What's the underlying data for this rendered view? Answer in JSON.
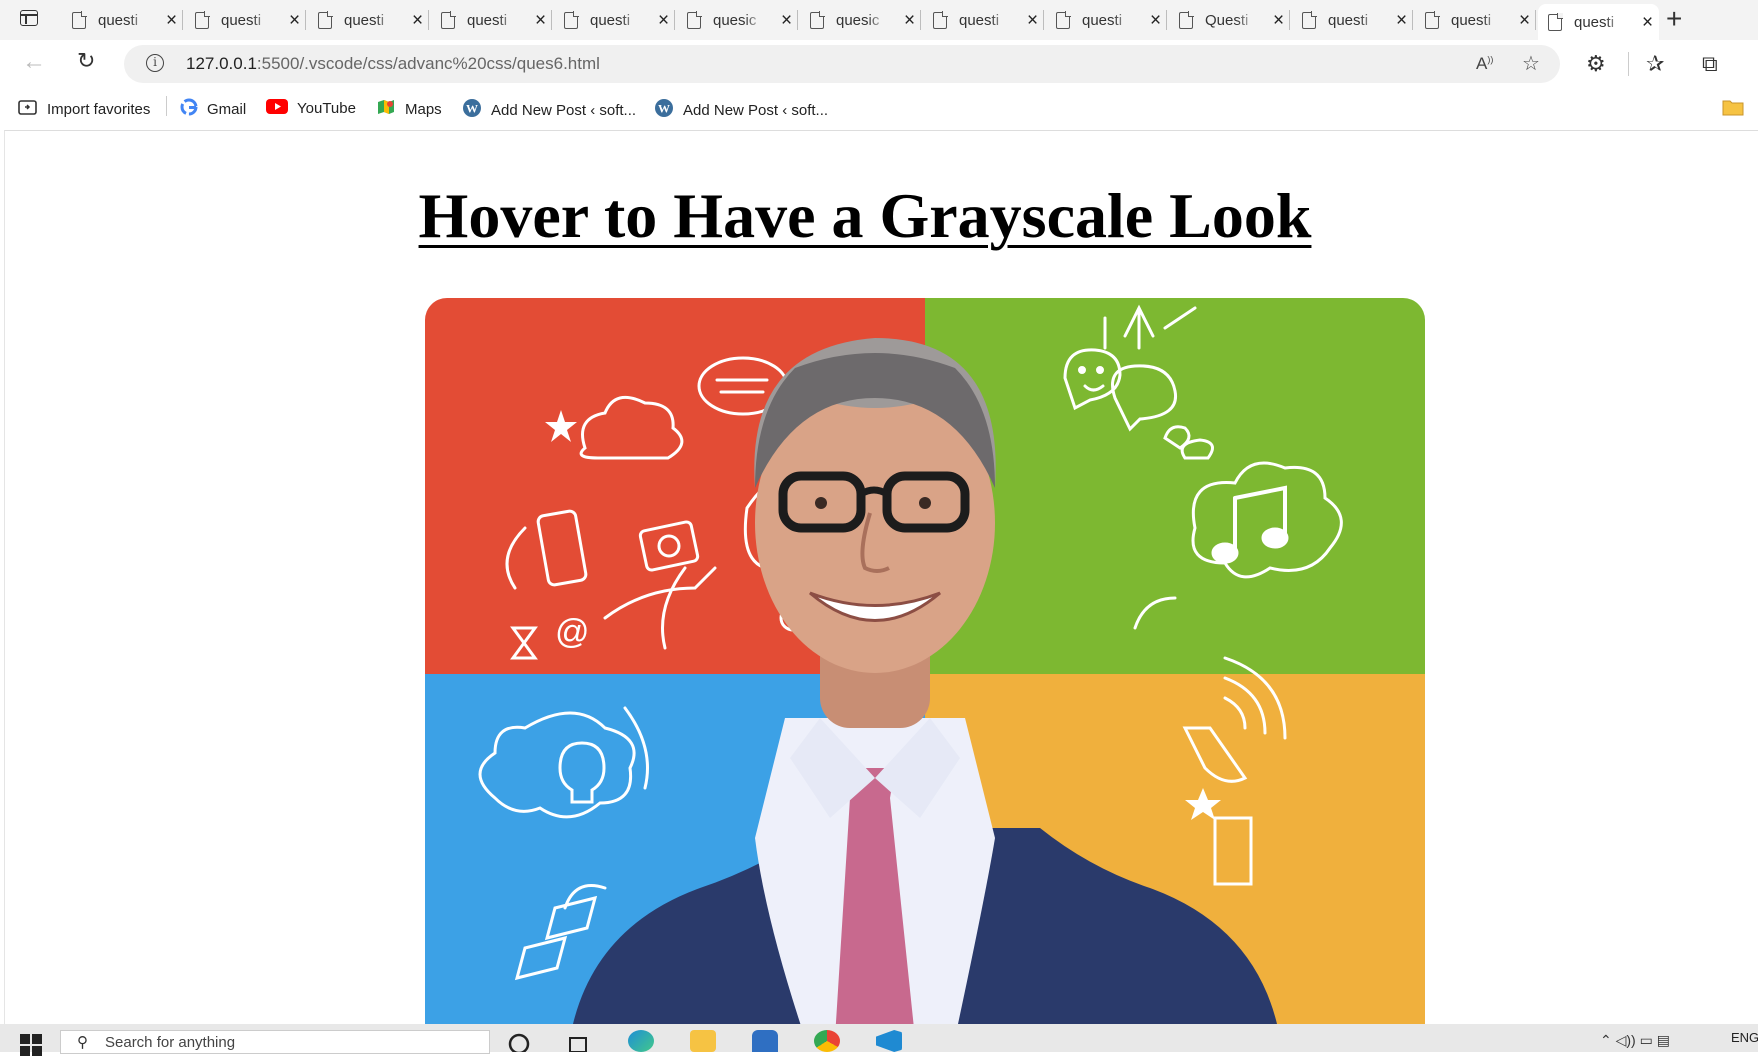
{
  "browser": {
    "tabs": [
      {
        "label": "questi",
        "active": false
      },
      {
        "label": "questi",
        "active": false
      },
      {
        "label": "questi",
        "active": false
      },
      {
        "label": "questi",
        "active": false
      },
      {
        "label": "questi",
        "active": false
      },
      {
        "label": "quesic",
        "active": false
      },
      {
        "label": "quesic",
        "active": false
      },
      {
        "label": "questi",
        "active": false
      },
      {
        "label": "questi",
        "active": false
      },
      {
        "label": "Questi",
        "active": false
      },
      {
        "label": "questi",
        "active": false
      },
      {
        "label": "questi",
        "active": false
      },
      {
        "label": "questi",
        "active": true
      }
    ],
    "address": {
      "host": "127.0.0.1",
      "path": ":5500/.vscode/css/advanc%20css/ques6.html"
    },
    "favorites": [
      {
        "label": "Import favorites",
        "icon": "import-favorites-icon"
      },
      {
        "label": "Gmail",
        "icon": "google-icon"
      },
      {
        "label": "YouTube",
        "icon": "youtube-icon"
      },
      {
        "label": "Maps",
        "icon": "maps-icon"
      },
      {
        "label": "Add New Post ‹ soft...",
        "icon": "wordpress-icon"
      },
      {
        "label": "Add New Post ‹ soft...",
        "icon": "wordpress-icon"
      }
    ]
  },
  "page": {
    "heading": "Hover to Have a Grayscale Look",
    "quadrant_colors": {
      "top_left": "#e34c35",
      "top_right": "#7db831",
      "bottom_left": "#3ca1e6",
      "bottom_right": "#f0b03d"
    }
  },
  "taskbar": {
    "search_placeholder": "Search for anything",
    "tray_text": "ENG"
  }
}
